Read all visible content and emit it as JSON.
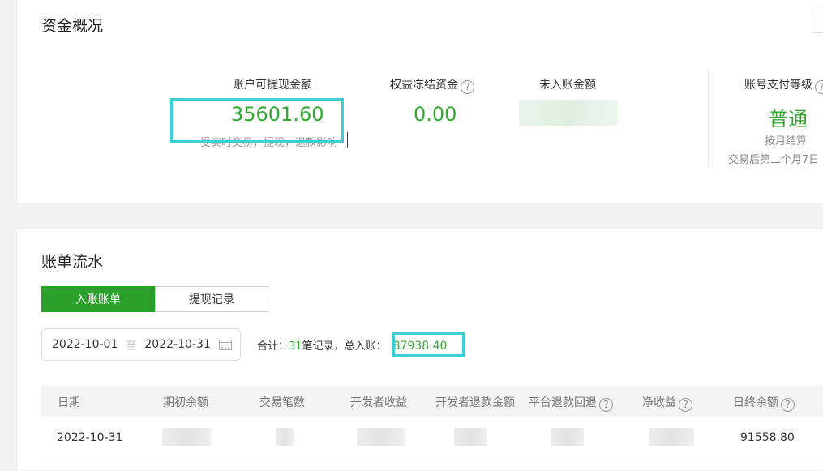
{
  "overview": {
    "title": "资金概况",
    "withdrawable": {
      "label": "账户可提现金额",
      "value": "35601.60",
      "note": "受实时交易，提现，退款影响"
    },
    "frozen": {
      "label": "权益冻结资金",
      "value": "0.00",
      "help": "?"
    },
    "pending": {
      "label": "未入账金额"
    },
    "level": {
      "label": "账号支付等级",
      "help": "?",
      "value": "普通",
      "settle": "按月结算",
      "note": "交易后第二个月7日"
    }
  },
  "bills": {
    "title": "账单流水",
    "tabs": [
      {
        "label": "入账账单",
        "active": true
      },
      {
        "label": "提现记录",
        "active": false
      }
    ],
    "date_start": "2022-10-01",
    "date_sep": "至",
    "date_end": "2022-10-31",
    "summary_prefix": "合计：",
    "summary_count": "31",
    "summary_mid": "笔记录，总入账：",
    "summary_total": "87938.40",
    "columns": [
      {
        "label": "日期",
        "help": ""
      },
      {
        "label": "期初余额",
        "help": ""
      },
      {
        "label": "交易笔数",
        "help": ""
      },
      {
        "label": "开发者收益",
        "help": ""
      },
      {
        "label": "开发者退款金额",
        "help": ""
      },
      {
        "label": "平台退款回退",
        "help": "?"
      },
      {
        "label": "净收益",
        "help": "?"
      },
      {
        "label": "日终余额",
        "help": "?"
      }
    ],
    "rows": [
      {
        "date": "2022-10-31",
        "end_balance": "91558.80"
      }
    ]
  },
  "colors": {
    "accent": "#2ba12b",
    "value_green": "#36a736",
    "highlight": "#3ccfcf"
  },
  "icons": {
    "help": "question-circle-icon",
    "calendar": "calendar-icon"
  }
}
